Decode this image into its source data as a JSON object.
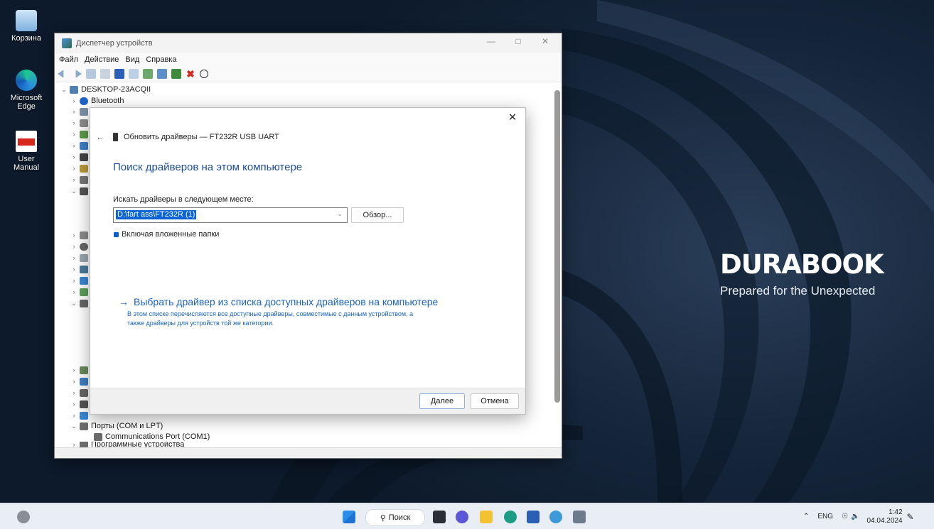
{
  "desktop": {
    "icons": [
      {
        "label": "Корзина"
      },
      {
        "label": "Microsoft Edge"
      },
      {
        "label": "User Manual"
      }
    ],
    "brand": {
      "logo": "DURABOOK",
      "tagline": "Prepared for the Unexpected"
    }
  },
  "device_manager": {
    "title": "Диспетчер устройств",
    "menu": [
      "Файл",
      "Действие",
      "Вид",
      "Справка"
    ],
    "tree": {
      "root": "DESKTOP-23ACQII",
      "bluetooth": "Bluetooth",
      "ports": "Порты (COM и LPT)",
      "com_port": "Communications Port (COM1)",
      "software_devices": "Программные устройства"
    }
  },
  "dialog": {
    "header": "Обновить драйверы — FT232R USB UART",
    "heading": "Поиск драйверов на этом компьютере",
    "search_label": "Искать драйверы в следующем месте:",
    "path_value": "D:\\fart ass\\FT232R (1)",
    "browse_label": "Обзор...",
    "include_subfolders": "Включая вложенные папки",
    "link_title": "Выбрать драйвер из списка доступных драйверов на компьютере",
    "link_desc": "В этом списке перечисляются все доступные драйверы, совместимые с данным устройством, а также драйверы для устройств той же категории.",
    "next_label": "Далее",
    "cancel_label": "Отмена"
  },
  "taskbar": {
    "search_label": "Поиск",
    "language": "ENG",
    "time": "1:42",
    "date": "04.04.2024"
  },
  "colors": {
    "accent": "#0a64d6",
    "link": "#1a63c0",
    "heading": "#1d4e97"
  }
}
